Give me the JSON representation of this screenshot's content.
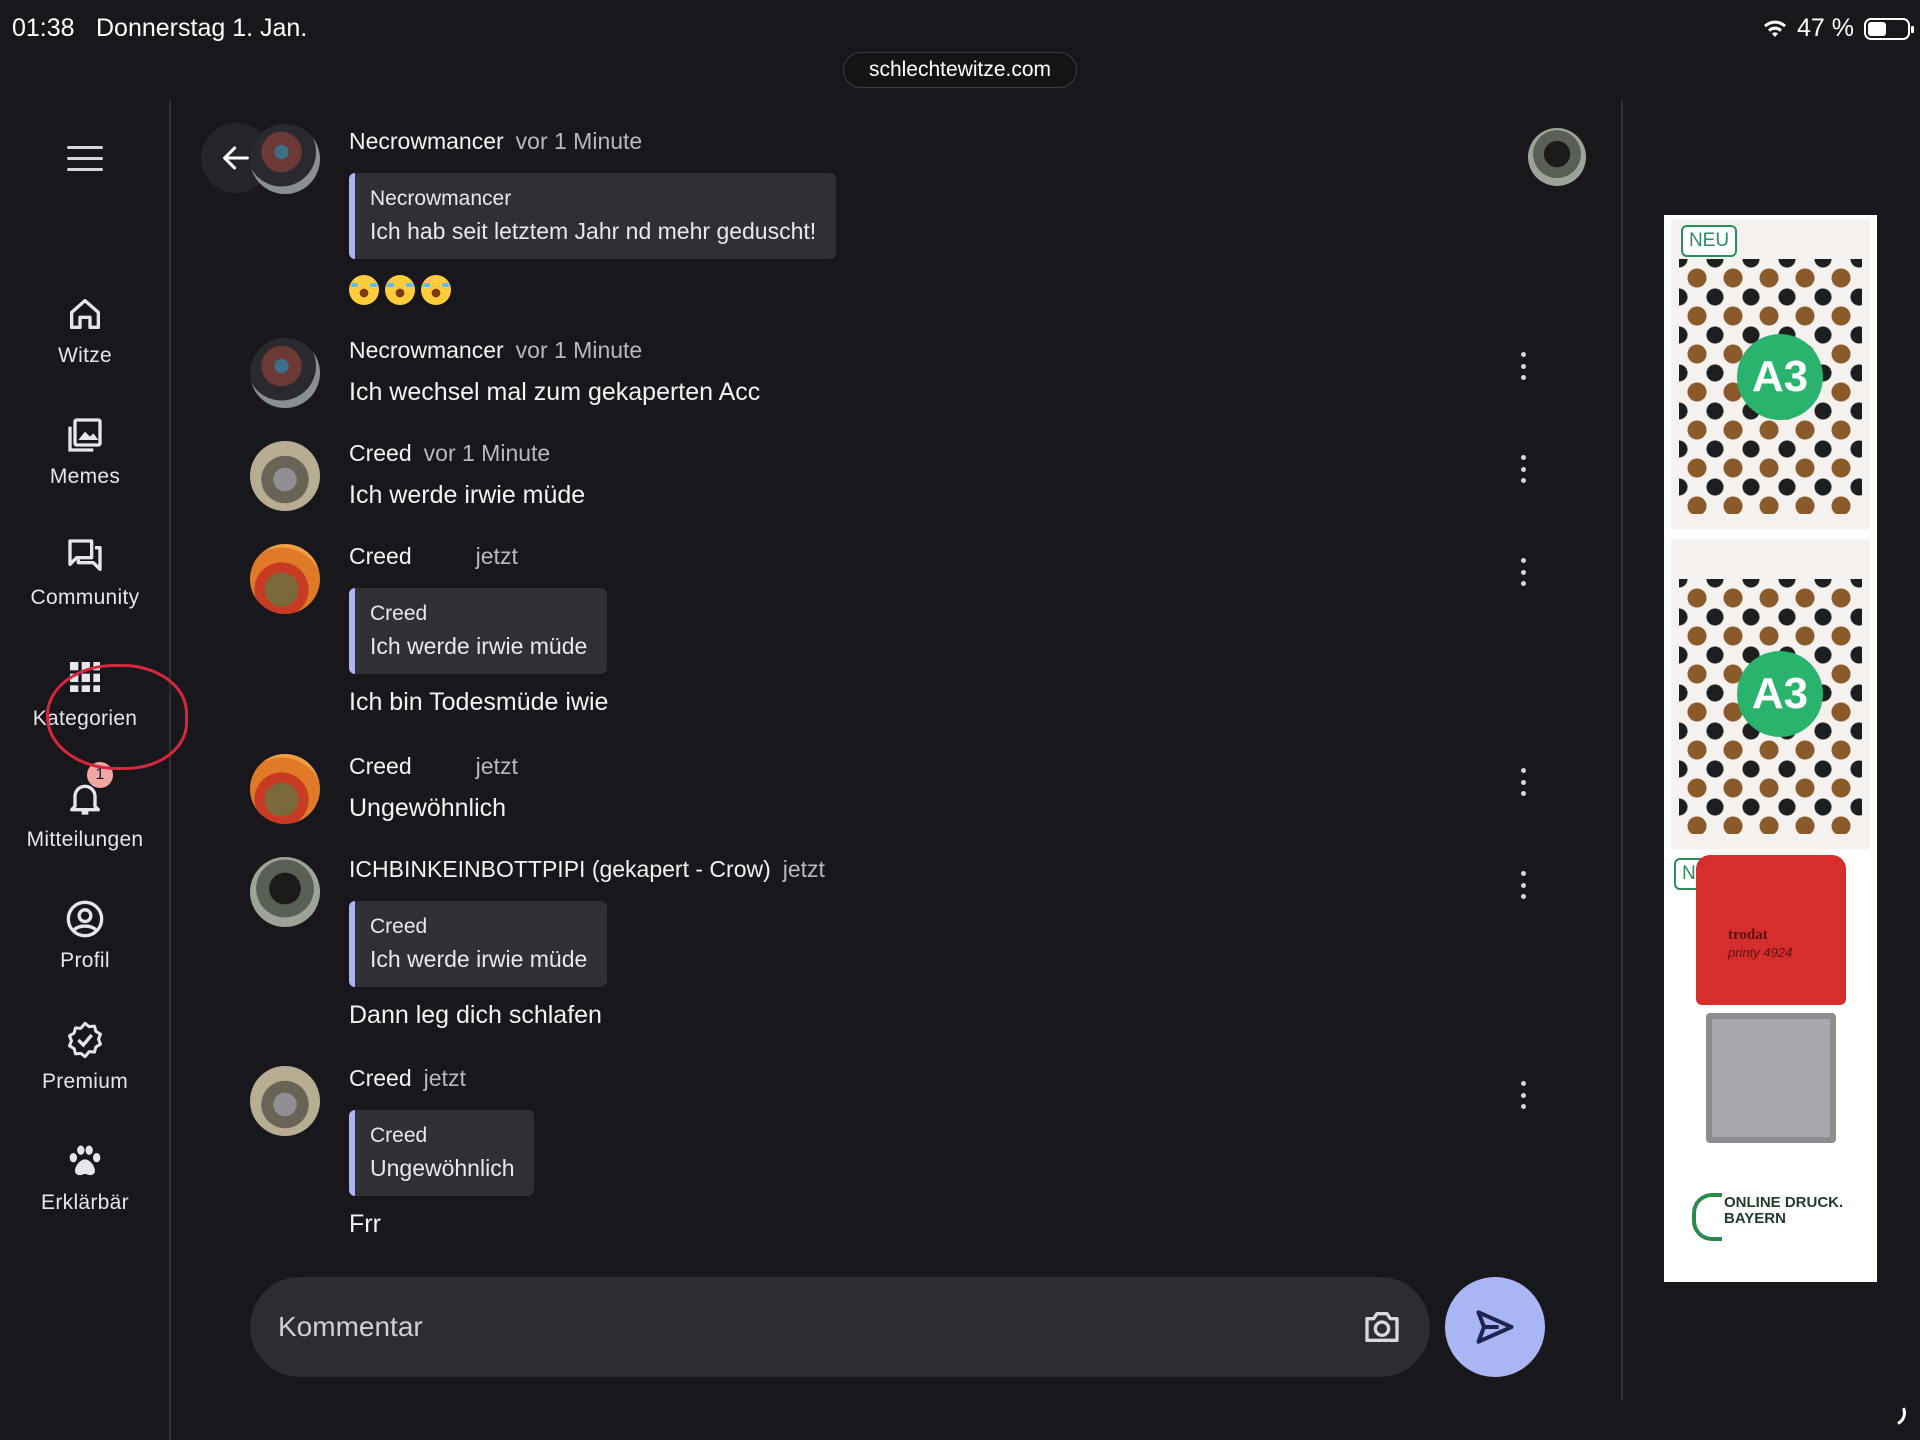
{
  "status_bar": {
    "time": "01:38",
    "date": "Donnerstag 1. Jan.",
    "battery": "47 %",
    "battery_level": 0.47
  },
  "browser": {
    "url": "schlechtewitze.com"
  },
  "sidebar": {
    "items": [
      {
        "label": "Witze",
        "icon": "home-icon"
      },
      {
        "label": "Memes",
        "icon": "images-icon"
      },
      {
        "label": "Community",
        "icon": "forum-icon"
      },
      {
        "label": "Kategorien",
        "icon": "grid-icon"
      },
      {
        "label": "Mitteilungen",
        "icon": "bell-icon",
        "badge": "1"
      },
      {
        "label": "Profil",
        "icon": "account-icon"
      },
      {
        "label": "Premium",
        "icon": "verified-icon"
      },
      {
        "label": "Erklärbär",
        "icon": "paw-icon"
      }
    ]
  },
  "messages": [
    {
      "author": "Necrowmancer",
      "time": "vor 1 Minute",
      "quote": {
        "author": "Necrowmancer",
        "text": "Ich hab seit letztem Jahr nd mehr geduscht!"
      },
      "emoji": "😂😂😂"
    },
    {
      "author": "Necrowmancer",
      "time": "vor 1 Minute",
      "text": "Ich wechsel mal zum gekaperten Acc"
    },
    {
      "author": "Creed",
      "time": "vor 1 Minute",
      "text": "Ich werde irwie müde"
    },
    {
      "author": "Creed",
      "time": "jetzt",
      "quote": {
        "author": "Creed",
        "text": "Ich werde irwie müde"
      },
      "text": "Ich bin Todesmüde iwie"
    },
    {
      "author": "Creed",
      "time": "jetzt",
      "text": "Ungewöhnlich"
    },
    {
      "author": "ICHBINKEINBOTTPIPI (gekapert - Crow)",
      "time": "jetzt",
      "quote": {
        "author": "Creed",
        "text": "Ich werde irwie müde"
      },
      "text": "Dann leg dich schlafen"
    },
    {
      "author": "Creed",
      "time": "jetzt",
      "quote": {
        "author": "Creed",
        "text": "Ungewöhnlich"
      },
      "text": "Frr"
    }
  ],
  "composer": {
    "placeholder": "Kommentar"
  },
  "ad": {
    "badge": "NEU",
    "product_label": "A3",
    "stamp_brand": "trodat",
    "stamp_model": "printy 4924",
    "advertiser": "ONLINE DRUCK. BAYERN"
  },
  "colors": {
    "background": "#18181c",
    "accent": "#aab6f4",
    "quote_bg": "#2f2f36"
  }
}
